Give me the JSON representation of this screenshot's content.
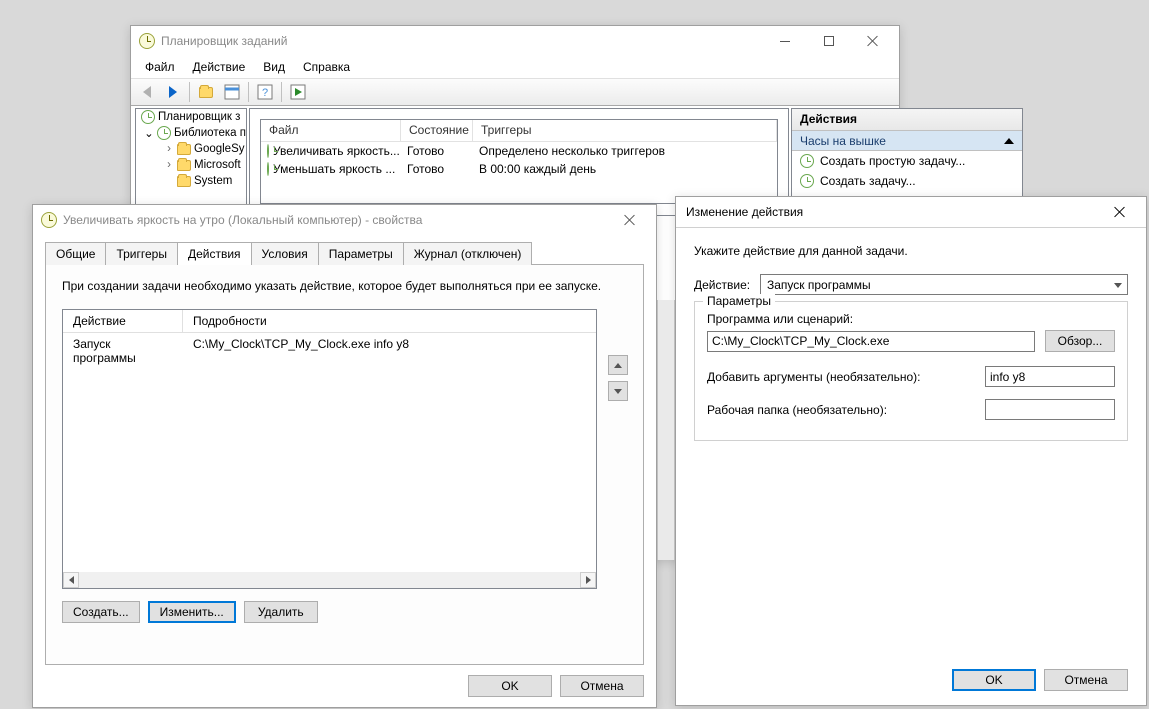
{
  "mainWindow": {
    "title": "Планировщик заданий",
    "menu": {
      "file": "Файл",
      "action": "Действие",
      "view": "Вид",
      "help": "Справка"
    },
    "tree": {
      "root": "Планировщик з",
      "lib": "Библиотека п",
      "items": [
        "GoogleSy",
        "Microsoft",
        "System"
      ]
    },
    "taskList": {
      "headers": {
        "file": "Файл",
        "state": "Состояние",
        "triggers": "Триггеры"
      },
      "rows": [
        {
          "name": "Увеличивать яркость...",
          "state": "Готово",
          "trigger": "Определено несколько триггеров"
        },
        {
          "name": "Уменьшать яркость ...",
          "state": "Готово",
          "trigger": "В 00:00 каждый день"
        }
      ]
    },
    "actionsPanel": {
      "title": "Действия",
      "sub": "Часы на вышке",
      "items": [
        "Создать простую задачу...",
        "Создать задачу..."
      ]
    }
  },
  "propsWindow": {
    "title": "Увеличивать яркость на утро (Локальный компьютер) - свойства",
    "tabs": {
      "general": "Общие",
      "triggers": "Триггеры",
      "actions": "Действия",
      "conditions": "Условия",
      "params": "Параметры",
      "journal": "Журнал (отключен)"
    },
    "desc": "При создании задачи необходимо указать действие, которое будет выполняться при ее запуске.",
    "table": {
      "headers": {
        "action": "Действие",
        "details": "Подробности"
      },
      "row": {
        "action": "Запуск программы",
        "details": "C:\\My_Clock\\TCP_My_Clock.exe info y8"
      }
    },
    "buttons": {
      "create": "Создать...",
      "edit": "Изменить...",
      "delete": "Удалить"
    },
    "ok": "OK",
    "cancel": "Отмена"
  },
  "editAction": {
    "title": "Изменение действия",
    "desc": "Укажите действие для данной задачи.",
    "actionLabel": "Действие:",
    "actionValue": "Запуск программы",
    "paramsGroup": "Параметры",
    "programLabel": "Программа или сценарий:",
    "programValue": "C:\\My_Clock\\TCP_My_Clock.exe",
    "browse": "Обзор...",
    "argsLabel": "Добавить аргументы (необязательно):",
    "argsValue": "info y8",
    "workdirLabel": "Рабочая папка (необязательно):",
    "workdirValue": "",
    "ok": "OK",
    "cancel": "Отмена"
  }
}
